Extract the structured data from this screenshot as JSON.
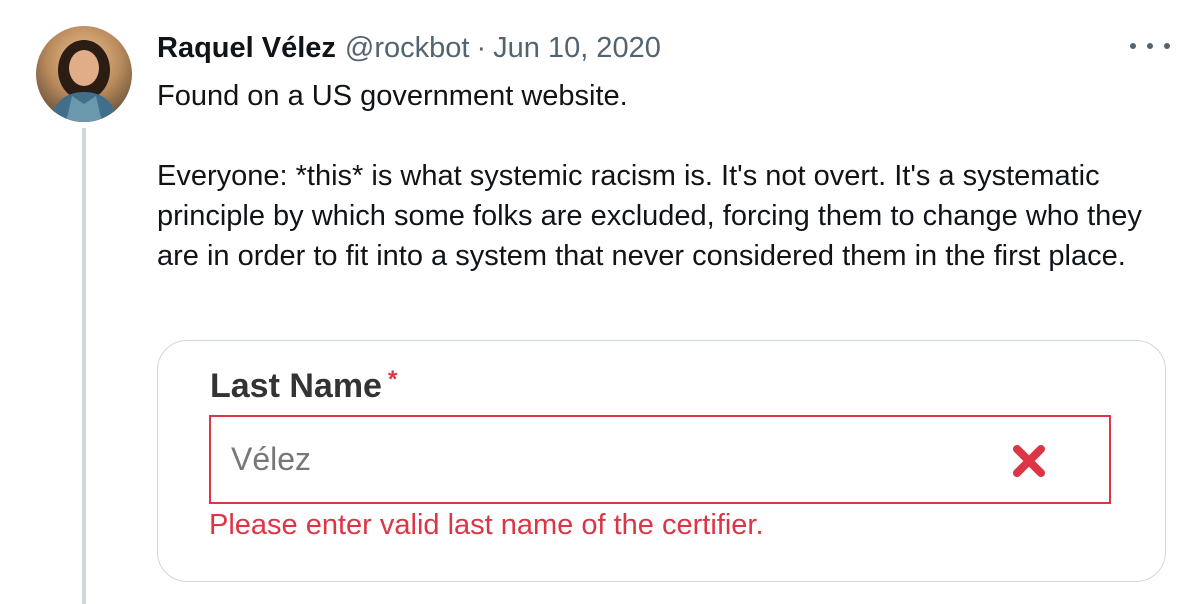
{
  "tweet": {
    "author": {
      "display_name": "Raquel Vélez",
      "handle": "@rockbot",
      "avatar_icon": "user-avatar"
    },
    "separator": "·",
    "date": "Jun 10, 2020",
    "more_icon": "more-options-icon",
    "text": {
      "line1": "Found on a US government website.",
      "paragraph2": "Everyone: *this* is what systemic racism is. It's not overt. It's a systematic principle by which some folks are excluded, forcing them to change who they are in order to fit into a system that never considered them in the first place."
    },
    "media": {
      "field_label": "Last Name",
      "required_marker": "*",
      "field_value": "Vélez",
      "error_icon": "error-x-icon",
      "error_message": "Please enter valid last name of the certifier.",
      "error_color": "#dc3545"
    }
  },
  "colors": {
    "text_primary": "#0f1419",
    "text_secondary": "#536471",
    "border": "#cfd9de"
  }
}
